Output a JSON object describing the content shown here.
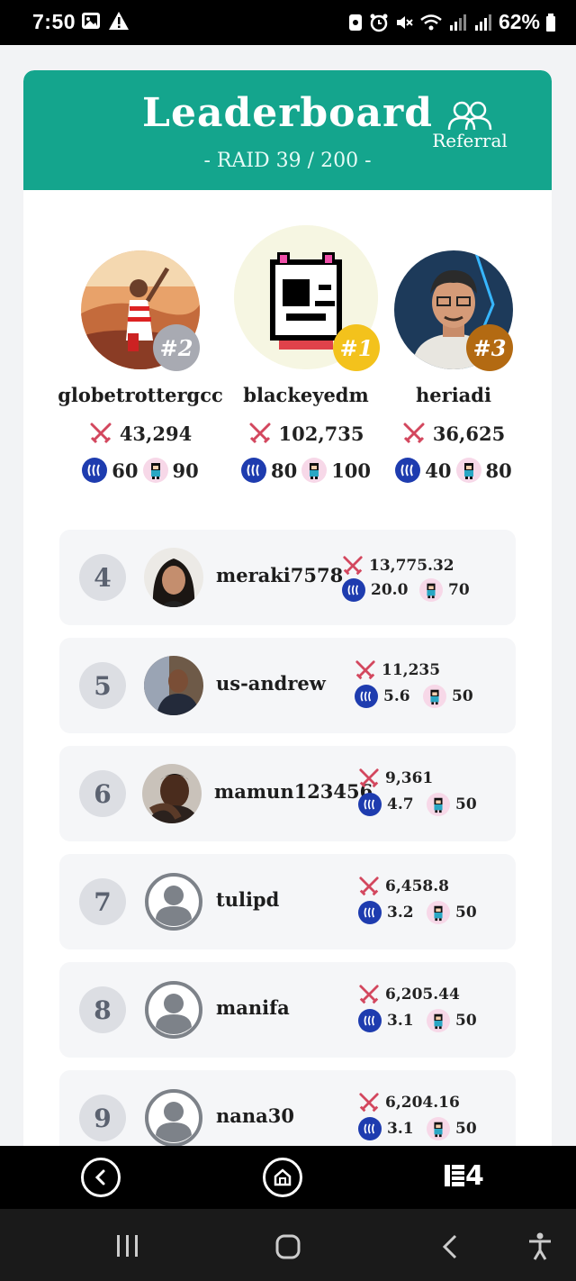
{
  "status_bar": {
    "time": "7:50",
    "battery": "62%"
  },
  "header": {
    "title": "Leaderboard",
    "subtitle": "- RAID 39 / 200 -",
    "referral_label": "Referral",
    "color": "#14a58d"
  },
  "podium": [
    {
      "rank_label": "#2",
      "username": "globetrottergcc",
      "power": "43,294",
      "steem": "60",
      "chars": "90",
      "badge_color": "#a8aab2"
    },
    {
      "rank_label": "#1",
      "username": "blackeyedm",
      "power": "102,735",
      "steem": "80",
      "chars": "100",
      "badge_color": "#f3c21c"
    },
    {
      "rank_label": "#3",
      "username": "heriadi",
      "power": "36,625",
      "steem": "40",
      "chars": "80",
      "badge_color": "#b36a12"
    }
  ],
  "rows": [
    {
      "rank": "4",
      "username": "meraki7578",
      "power": "13,775.32",
      "steem": "20.0",
      "chars": "70"
    },
    {
      "rank": "5",
      "username": "us-andrew",
      "power": "11,235",
      "steem": "5.6",
      "chars": "50"
    },
    {
      "rank": "6",
      "username": "mamun123456",
      "power": "9,361",
      "steem": "4.7",
      "chars": "50"
    },
    {
      "rank": "7",
      "username": "tulipd",
      "power": "6,458.8",
      "steem": "3.2",
      "chars": "50"
    },
    {
      "rank": "8",
      "username": "manifa",
      "power": "6,205.44",
      "steem": "3.1",
      "chars": "50"
    },
    {
      "rank": "9",
      "username": "nana30",
      "power": "6,204.16",
      "steem": "3.1",
      "chars": "50"
    }
  ],
  "app_nav": {
    "items": [
      "back-icon",
      "home-icon",
      "brand-logo"
    ],
    "brand": "4"
  },
  "system_nav": {
    "items": [
      "recent-apps-icon",
      "home-icon",
      "back-icon",
      "accessibility-icon"
    ]
  }
}
